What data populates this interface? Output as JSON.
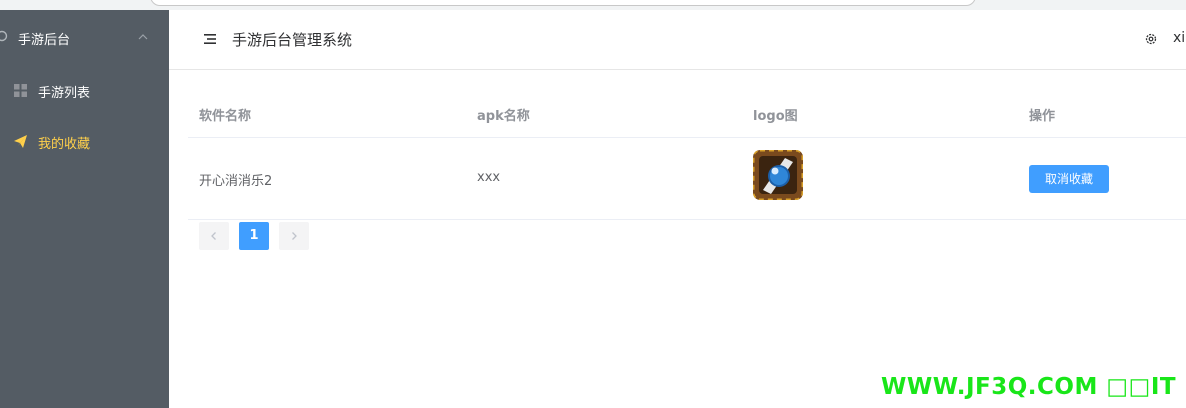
{
  "sidebar": {
    "header_label": "手游后台",
    "items": [
      {
        "label": "手游列表",
        "icon": "grid-icon",
        "active": false
      },
      {
        "label": "我的收藏",
        "icon": "paper-plane-icon",
        "active": true
      }
    ],
    "background": "#545c64",
    "active_color": "#ffd04b"
  },
  "header": {
    "title": "手游后台管理系统",
    "user": "xi"
  },
  "table": {
    "columns": [
      "软件名称",
      "apk名称",
      "logo图",
      "操作"
    ],
    "rows": [
      {
        "name": "开心消消乐2",
        "apk": "xxx",
        "logo_icon": "game-logo-icon",
        "action": "取消收藏"
      }
    ]
  },
  "pagination": {
    "current": "1",
    "prev_icon": "chevron-left-icon",
    "next_icon": "chevron-right-icon"
  },
  "watermark": "WWW.JF3Q.COM □□IT",
  "colors": {
    "primary": "#409eff",
    "watermark": "#19e619"
  }
}
